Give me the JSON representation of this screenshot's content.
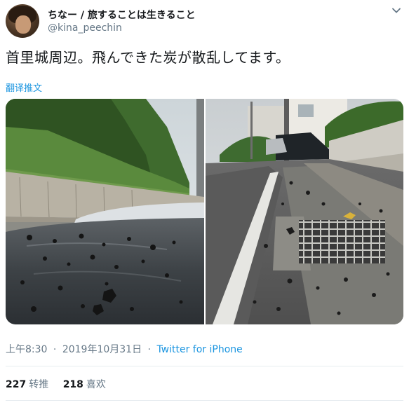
{
  "user": {
    "display_name": "ちなー / 旅することは生きること",
    "screen_name": "@kina_peechin"
  },
  "tweet": {
    "text": "首里城周辺。飛んできた炭が散乱してます。",
    "translate_label": "翻译推文"
  },
  "meta": {
    "time": "上午8:30",
    "date": "2019年10月31日",
    "separator": "·",
    "source": "Twitter for iPhone"
  },
  "stats": {
    "retweets_count": "227",
    "retweets_label": "转推",
    "likes_count": "218",
    "likes_label": "喜欢"
  },
  "icons": {
    "caret": "chevron-down-icon"
  },
  "colors": {
    "link": "#1b95e0",
    "secondary_text": "#657786",
    "primary_text": "#14171a",
    "divider": "#e6ecf0"
  }
}
